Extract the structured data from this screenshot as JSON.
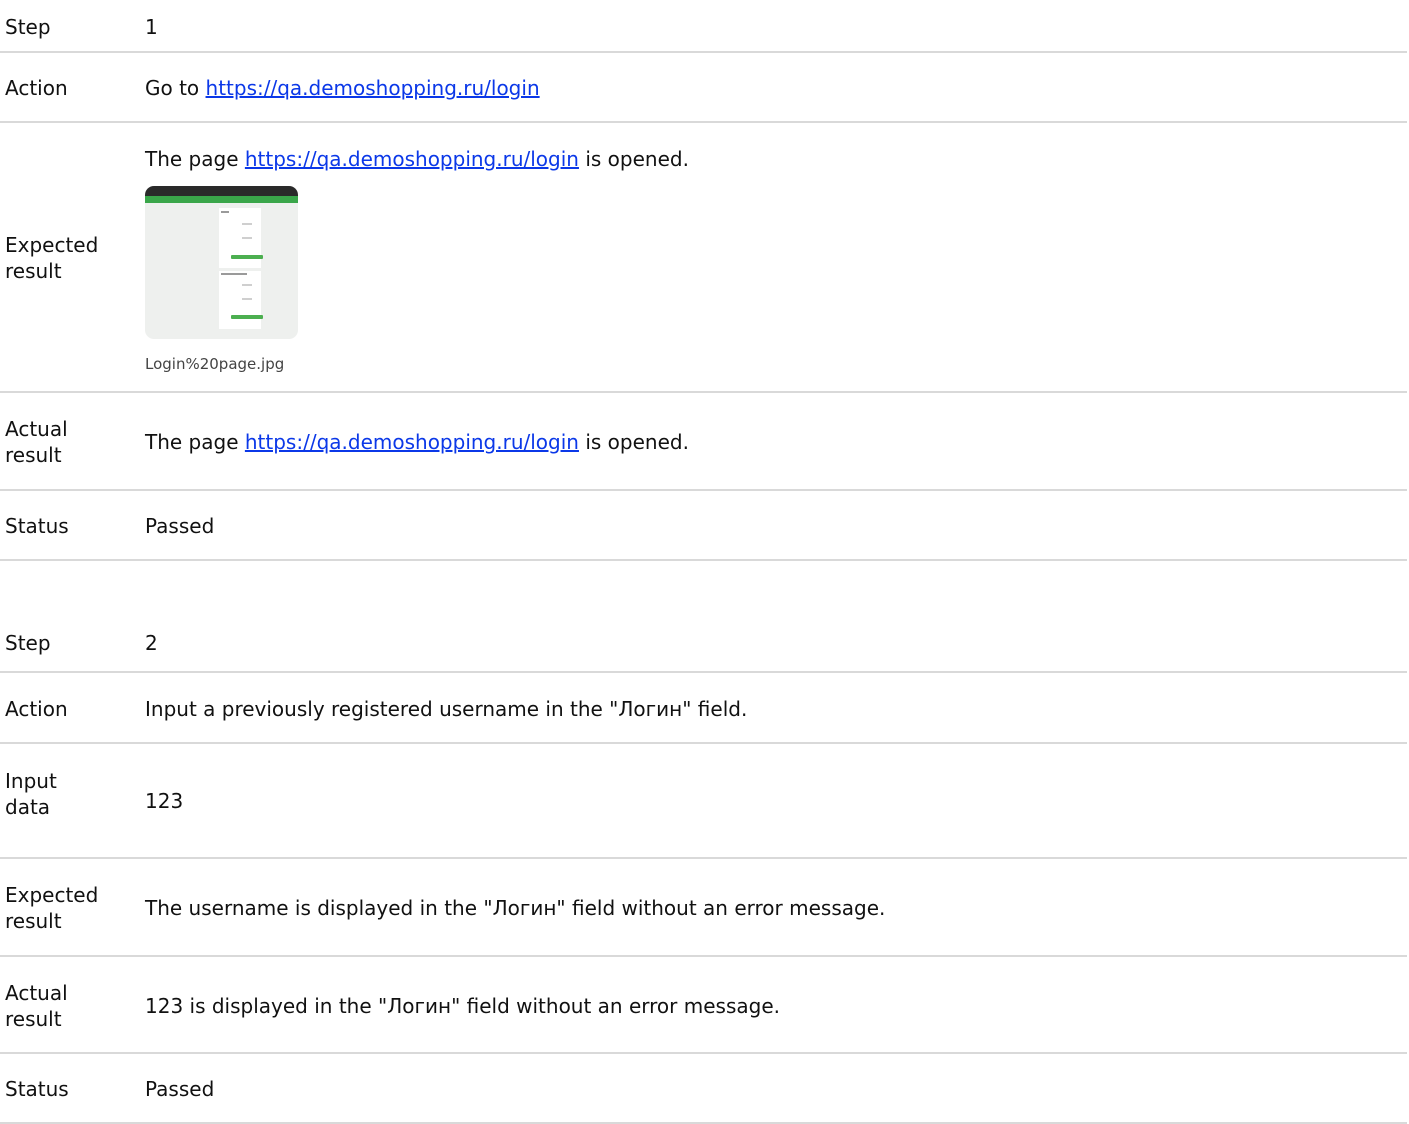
{
  "steps": [
    {
      "step_label": "Step",
      "step_value": "1",
      "action_label": "Action",
      "action_prefix": "Go to",
      "action_link": "https://qa.demoshopping.ru/login",
      "expected_label_1": "Expected",
      "expected_label_2": "result",
      "expected_prefix": "The page",
      "expected_link": "https://qa.demoshopping.ru/login",
      "expected_suffix": "is opened.",
      "attachment_name": "Login%20page.jpg",
      "actual_label_1": "Actual",
      "actual_label_2": "result",
      "actual_prefix": "The page",
      "actual_link": "https://qa.demoshopping.ru/login",
      "actual_suffix": "is opened.",
      "status_label": "Status",
      "status_value": "Passed"
    },
    {
      "step_label": "Step",
      "step_value": "2",
      "action_label": "Action",
      "action_text": "Input a previously registered username in the \"Логин\" field.",
      "input_label_1": "Input",
      "input_label_2": "data",
      "input_value": "123",
      "expected_label_1": "Expected",
      "expected_label_2": "result",
      "expected_text": "The username is displayed in the \"Логин\" field without an error message.",
      "actual_label_1": "Actual",
      "actual_label_2": "result",
      "actual_text": "123 is displayed in the \"Логин\" field without an error message.",
      "status_label": "Status",
      "status_value": "Passed"
    }
  ]
}
